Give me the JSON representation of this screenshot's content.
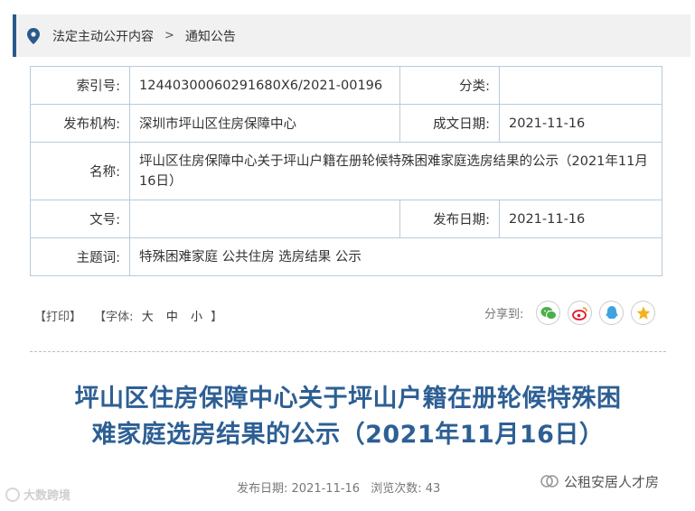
{
  "breadcrumb": {
    "items": [
      "法定主动公开内容",
      "通知公告"
    ],
    "separator": ">"
  },
  "meta": {
    "index_label": "索引号:",
    "index_value": "12440300060291680X6/2021-00196",
    "category_label": "分类:",
    "category_value": "",
    "publisher_label": "发布机构:",
    "publisher_value": "深圳市坪山区住房保障中心",
    "created_label": "成文日期:",
    "created_value": "2021-11-16",
    "name_label": "名称:",
    "name_value": "坪山区住房保障中心关于坪山户籍在册轮候特殊困难家庭选房结果的公示（2021年11月16日）",
    "docno_label": "文号:",
    "docno_value": "",
    "publish_label": "发布日期:",
    "publish_value": "2021-11-16",
    "keywords_label": "主题词:",
    "keywords_value": "特殊困难家庭 公共住房 选房结果 公示"
  },
  "tools": {
    "print": "【打印】",
    "font_prefix": "【字体:",
    "font_large": "大",
    "font_medium": "中",
    "font_small": "小",
    "font_suffix": "】"
  },
  "share": {
    "label": "分享到:",
    "icons": [
      "wechat-icon",
      "weibo-icon",
      "qq-icon",
      "qzone-icon"
    ]
  },
  "article": {
    "title_line1": "坪山区住房保障中心关于坪山户籍在册轮候特殊困",
    "title_line2": "难家庭选房结果的公示（2021年11月16日）",
    "pub_label": "发布日期:",
    "pub_date": "2021-11-16",
    "views_label": "浏览次数:",
    "views": "43"
  },
  "watermarks": {
    "left": "大数跨境",
    "right": "公租安居人才房"
  },
  "colors": {
    "accent": "#2a5a8c",
    "title": "#2d5f94",
    "table_border": "#b9cbd9",
    "wechat": "#4cb04a",
    "weibo": "#e6162d",
    "qq": "#3fa3e0",
    "qzone": "#f2b21c"
  }
}
